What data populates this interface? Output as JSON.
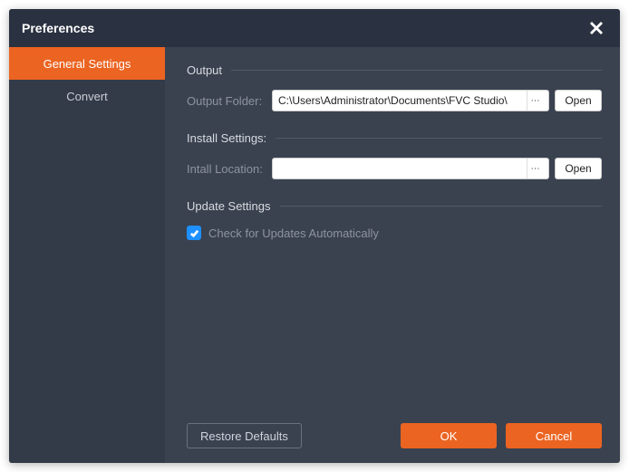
{
  "titlebar": {
    "title": "Preferences"
  },
  "sidebar": {
    "items": [
      {
        "label": "General Settings",
        "active": true
      },
      {
        "label": "Convert",
        "active": false
      }
    ]
  },
  "sections": {
    "output": {
      "title": "Output",
      "folder_label": "Output Folder:",
      "folder_value": "C:\\Users\\Administrator\\Documents\\FVC Studio\\",
      "browse_label": "⋯",
      "open_label": "Open"
    },
    "install": {
      "title": "Install Settings:",
      "location_label": "Intall Location:",
      "location_value": "",
      "browse_label": "⋯",
      "open_label": "Open"
    },
    "update": {
      "title": "Update Settings",
      "checkbox_label": "Check for Updates Automatically",
      "checked": true
    }
  },
  "footer": {
    "restore_label": "Restore Defaults",
    "ok_label": "OK",
    "cancel_label": "Cancel"
  },
  "colors": {
    "accent": "#eb6422",
    "bg": "#3a4250",
    "sidebar_bg": "#333a48",
    "titlebar_bg": "#2a3140"
  }
}
